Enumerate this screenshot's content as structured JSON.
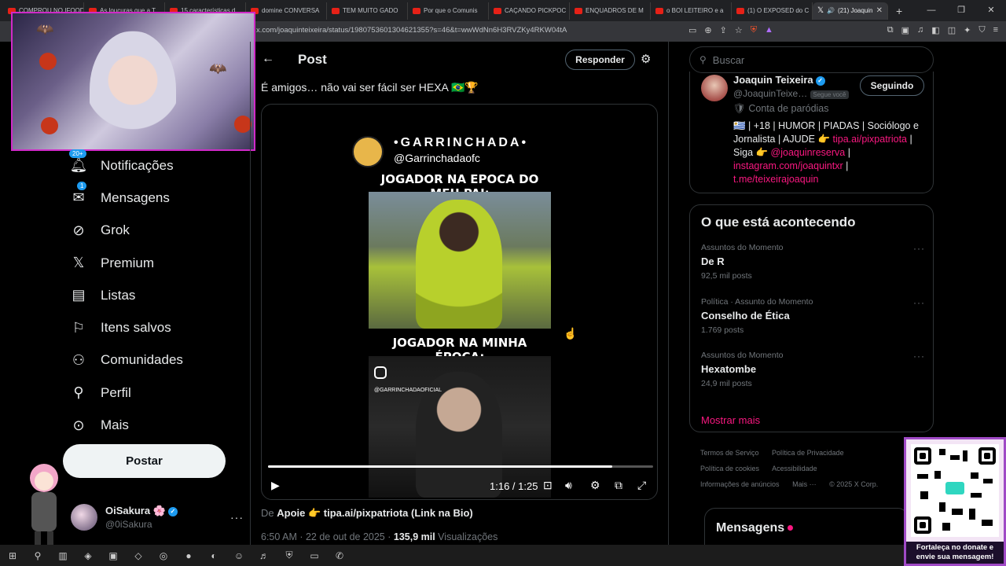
{
  "browser": {
    "tabs": [
      {
        "label": "COMPROU NO IFOOD"
      },
      {
        "label": "As loucuras que a T"
      },
      {
        "label": "15 características d"
      },
      {
        "label": "domine CONVERSA"
      },
      {
        "label": "TEM MUITO GADO"
      },
      {
        "label": "Por que o Comunis"
      },
      {
        "label": "CAÇANDO PICKPOC"
      },
      {
        "label": "ENQUADROS DE M"
      },
      {
        "label": "o BOI LEITEIRO e a"
      },
      {
        "label": "(1) O EXPOSED do C"
      }
    ],
    "active_tab": {
      "label": "(21) Joaquin"
    },
    "url": "x.com/joaquinteixeira/status/1980753601304621355?s=46&t=wwWdNn6H3RVZKy4RKW04tA"
  },
  "nav": {
    "items": [
      {
        "label": "Notificações",
        "icon": "bell-icon",
        "badge": "20+"
      },
      {
        "label": "Mensagens",
        "icon": "envelope-icon",
        "badge": "1"
      },
      {
        "label": "Grok",
        "icon": "grok-icon"
      },
      {
        "label": "Premium",
        "icon": "x-logo-icon"
      },
      {
        "label": "Listas",
        "icon": "list-icon"
      },
      {
        "label": "Itens salvos",
        "icon": "bookmark-icon"
      },
      {
        "label": "Comunidades",
        "icon": "communities-icon"
      },
      {
        "label": "Perfil",
        "icon": "person-icon"
      },
      {
        "label": "Mais",
        "icon": "more-circle-icon"
      }
    ],
    "post_label": "Postar",
    "account": {
      "name": "OiSakura 🌸",
      "handle": "@0iSakura"
    }
  },
  "main": {
    "title": "Post",
    "reply_label": "Responder",
    "tweet_text": "É amigos… não vai ser fácil ser HEXA 🇧🇷🏆",
    "video": {
      "brand": "•GARRINCHADA•",
      "handle": "@Garrinchadaofc",
      "caption_top": "JOGADOR NA EPOCA DO MEU PAI:",
      "caption_bottom": "JOGADOR NA MINHA ÉPOCA:",
      "ig_handle": "@GARRINCHADAOFICIAL",
      "time": "1:16 / 1:25",
      "progress": 0.894
    },
    "source_prefix": "De ",
    "source_text": "Apoie 👉 tipa.ai/pixpatriota (Link na Bio)",
    "meta_time": "6:50 AM · 22 de out de 2025 · ",
    "meta_views": "135,9 mil",
    "meta_views_label": " Visualizações"
  },
  "right": {
    "search_placeholder": "Buscar",
    "profile": {
      "name": "Joaquin Teixeira",
      "handle": "@JoaquinTeixe…",
      "follows_you": "Segue você",
      "follow_label": "Seguindo",
      "parody": "Conta de paródias",
      "bio_text": "🇺🇾 | +18 | HUMOR | PIADAS | Sociólogo e Jornalista | AJUDE 👉 ",
      "bio_link1": "tipa.ai/pixpatriota",
      "bio_mid": " | Siga 👉 ",
      "bio_link2": "@joaquinreserva",
      "bio_sep": " | ",
      "bio_link3": "instagram.com/joaquintxr",
      "bio_sep2": " | ",
      "bio_link4": "t.me/teixeirajoaquin"
    },
    "trends_title": "O que está acontecendo",
    "trends": [
      {
        "context": "Assuntos do Momento",
        "name": "De R",
        "count": "92,5 mil posts"
      },
      {
        "context": "Política · Assunto do Momento",
        "name": "Conselho de Ética",
        "count": "1.769 posts"
      },
      {
        "context": "Assuntos do Momento",
        "name": "Hexatombe",
        "count": "24,9 mil posts"
      }
    ],
    "show_more": "Mostrar mais",
    "footer": [
      "Termos de Serviço",
      "Política de Privacidade",
      "Política de cookies",
      "Acessibilidade",
      "Informações de anúncios",
      "Mais ···",
      "© 2025 X Corp."
    ],
    "messages_label": "Mensagens"
  },
  "overlay": {
    "qr_caption": "Fortaleça no donate e envie sua mensagem!"
  }
}
